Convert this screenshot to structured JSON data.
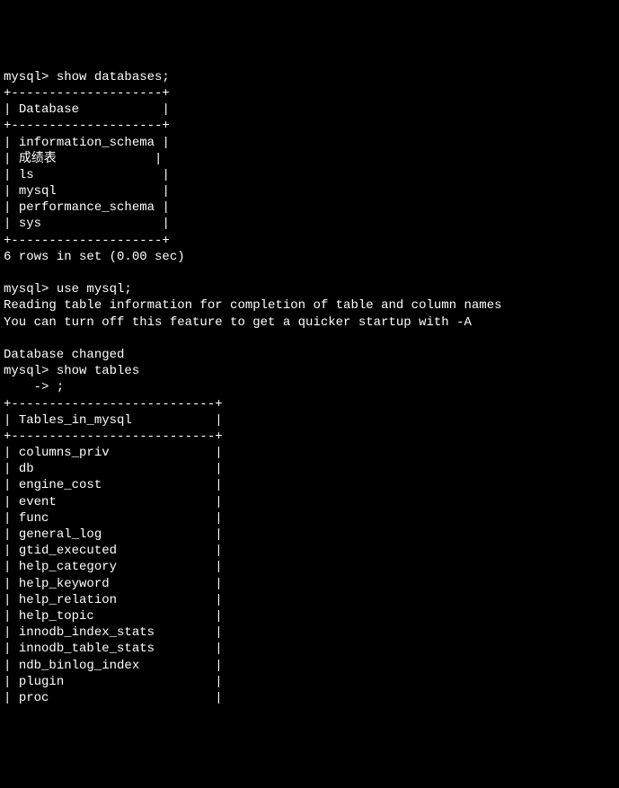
{
  "prompt1": "mysql> ",
  "command1": "show databases;",
  "table1_border_top": "+--------------------+",
  "table1_header_prefix": "| ",
  "table1_header": "Database",
  "table1_header_suffix": "           |",
  "table1_border_mid": "+--------------------+",
  "databases": [
    {
      "prefix": "| ",
      "name": "information_schema",
      "suffix": " |"
    },
    {
      "prefix": "| ",
      "name": "成绩表",
      "suffix": "             |"
    },
    {
      "prefix": "| ",
      "name": "ls",
      "suffix": "                 |"
    },
    {
      "prefix": "| ",
      "name": "mysql",
      "suffix": "              |"
    },
    {
      "prefix": "| ",
      "name": "performance_schema",
      "suffix": " |"
    },
    {
      "prefix": "| ",
      "name": "sys",
      "suffix": "                |"
    }
  ],
  "table1_border_bot": "+--------------------+",
  "summary1": "6 rows in set (0.00 sec)",
  "blank1": "",
  "prompt2": "mysql> ",
  "command2": "use mysql;",
  "info_line1": "Reading table information for completion of table and column names",
  "info_line2": "You can turn off this feature to get a quicker startup with -A",
  "blank2": "",
  "db_changed": "Database changed",
  "prompt3": "mysql> ",
  "command3": "show tables",
  "prompt_cont": "    -> ",
  "command3_cont": ";",
  "table2_border_top": "+---------------------------+",
  "table2_header_prefix": "| ",
  "table2_header": "Tables_in_mysql",
  "table2_header_suffix": "           |",
  "table2_border_mid": "+---------------------------+",
  "tables": [
    {
      "prefix": "| ",
      "name": "columns_priv",
      "suffix": "              |"
    },
    {
      "prefix": "| ",
      "name": "db",
      "suffix": "                        |"
    },
    {
      "prefix": "| ",
      "name": "engine_cost",
      "suffix": "               |"
    },
    {
      "prefix": "| ",
      "name": "event",
      "suffix": "                     |"
    },
    {
      "prefix": "| ",
      "name": "func",
      "suffix": "                      |"
    },
    {
      "prefix": "| ",
      "name": "general_log",
      "suffix": "               |"
    },
    {
      "prefix": "| ",
      "name": "gtid_executed",
      "suffix": "             |"
    },
    {
      "prefix": "| ",
      "name": "help_category",
      "suffix": "             |"
    },
    {
      "prefix": "| ",
      "name": "help_keyword",
      "suffix": "              |"
    },
    {
      "prefix": "| ",
      "name": "help_relation",
      "suffix": "             |"
    },
    {
      "prefix": "| ",
      "name": "help_topic",
      "suffix": "                |"
    },
    {
      "prefix": "| ",
      "name": "innodb_index_stats",
      "suffix": "        |"
    },
    {
      "prefix": "| ",
      "name": "innodb_table_stats",
      "suffix": "        |"
    },
    {
      "prefix": "| ",
      "name": "ndb_binlog_index",
      "suffix": "          |"
    },
    {
      "prefix": "| ",
      "name": "plugin",
      "suffix": "                    |"
    },
    {
      "prefix": "| ",
      "name": "proc",
      "suffix": "                      |"
    }
  ]
}
